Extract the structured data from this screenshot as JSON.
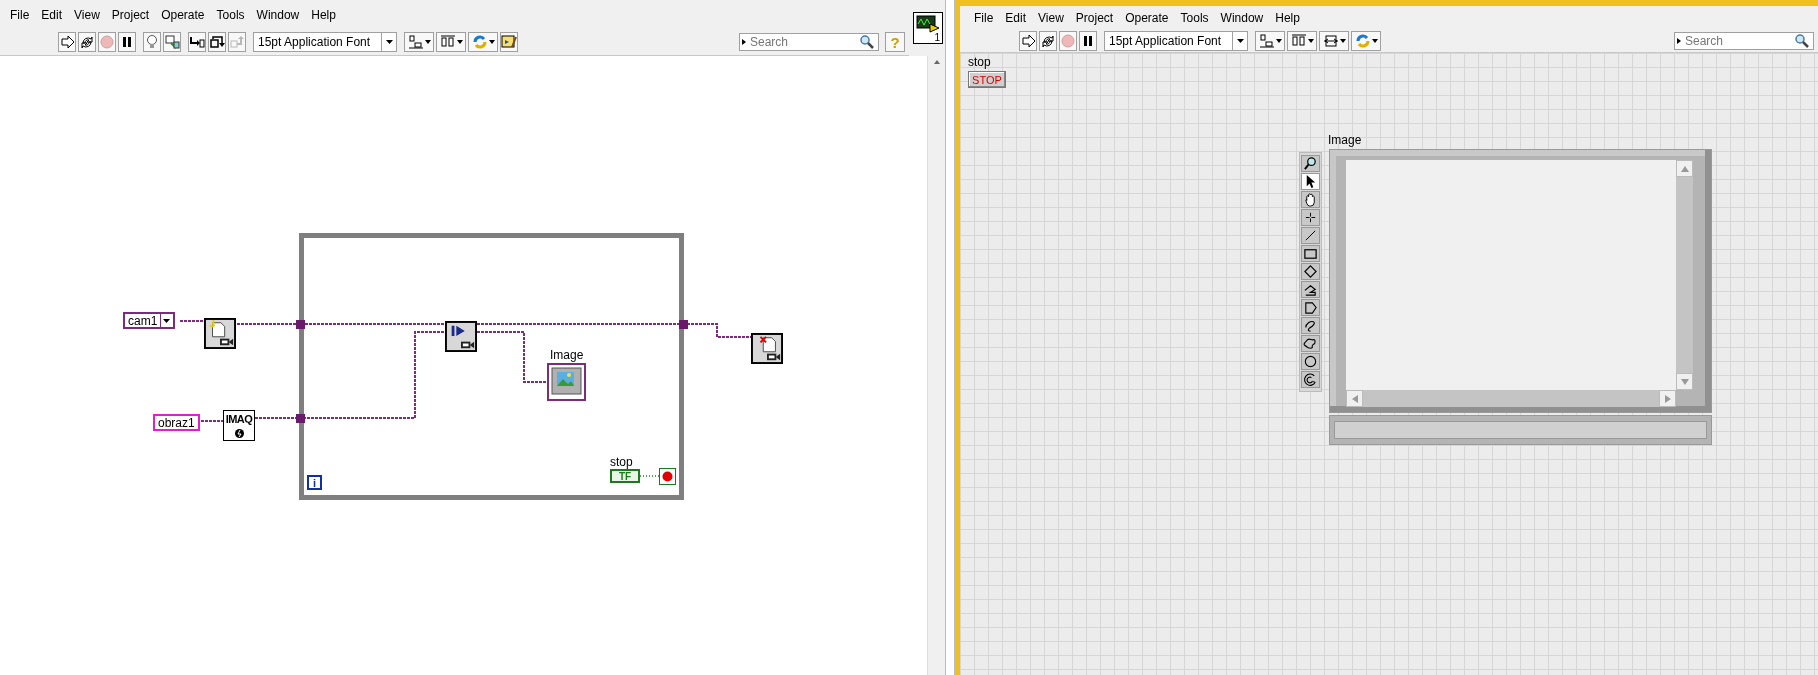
{
  "block_diagram": {
    "menu": [
      "File",
      "Edit",
      "View",
      "Project",
      "Operate",
      "Tools",
      "Window",
      "Help"
    ],
    "toolbar": [
      {
        "kind": "run",
        "disabled": false
      },
      {
        "kind": "run-continuously",
        "disabled": false
      },
      {
        "kind": "abort",
        "disabled": true
      },
      {
        "kind": "pause",
        "disabled": false
      },
      {
        "kind": "highlight",
        "disabled": false
      },
      {
        "kind": "retain",
        "disabled": false
      },
      {
        "kind": "step-into",
        "disabled": false
      },
      {
        "kind": "step-over",
        "disabled": false
      },
      {
        "kind": "step-out",
        "disabled": true
      },
      {
        "kind": "font",
        "text": "15pt Application Font",
        "disabled": false
      },
      {
        "kind": "align",
        "disabled": false
      },
      {
        "kind": "distribute",
        "disabled": false
      },
      {
        "kind": "reorder",
        "disabled": false
      },
      {
        "kind": "cleanup",
        "disabled": false
      }
    ],
    "search": {
      "placeholder": "Search"
    },
    "help": "?",
    "connector_pane": "1",
    "constants": [
      {
        "kind": "session",
        "text": "cam1"
      },
      {
        "kind": "string",
        "text": "obraz1"
      }
    ],
    "functions": [
      {
        "kind": "open"
      },
      {
        "kind": "create",
        "text": "IMAQ"
      },
      {
        "kind": "grab"
      },
      {
        "kind": "close"
      }
    ],
    "image_terminal": {
      "label": "Image"
    },
    "stop_terminal": {
      "label": "stop",
      "text": "TF"
    },
    "loop": {
      "iteration": "i"
    }
  },
  "front_panel": {
    "menu": [
      "File",
      "Edit",
      "View",
      "Project",
      "Operate",
      "Tools",
      "Window",
      "Help"
    ],
    "toolbar": [
      {
        "kind": "run",
        "disabled": false
      },
      {
        "kind": "run-continuously",
        "disabled": false
      },
      {
        "kind": "abort",
        "disabled": true
      },
      {
        "kind": "pause",
        "disabled": false
      },
      {
        "kind": "font",
        "text": "15pt Application Font",
        "disabled": false
      },
      {
        "kind": "align",
        "disabled": false
      },
      {
        "kind": "distribute",
        "disabled": false
      },
      {
        "kind": "resize",
        "disabled": false
      },
      {
        "kind": "reorder",
        "disabled": false
      }
    ],
    "search": {
      "placeholder": "Search"
    },
    "stop_button": {
      "label": "stop",
      "text": "STOP"
    },
    "image_display": {
      "label": "Image",
      "tools": [
        {
          "kind": "zoom",
          "selected": false
        },
        {
          "kind": "pointer",
          "selected": true
        },
        {
          "kind": "pan",
          "selected": false
        },
        {
          "kind": "point",
          "selected": false
        },
        {
          "kind": "line",
          "selected": false
        },
        {
          "kind": "rectangle",
          "selected": false
        },
        {
          "kind": "rotated-rectangle",
          "selected": false
        },
        {
          "kind": "polyline",
          "selected": false
        },
        {
          "kind": "polygon",
          "selected": false
        },
        {
          "kind": "freehand-line",
          "selected": false
        },
        {
          "kind": "freehand-region",
          "selected": false
        },
        {
          "kind": "oval",
          "selected": false
        },
        {
          "kind": "annulus",
          "selected": false
        }
      ]
    }
  }
}
